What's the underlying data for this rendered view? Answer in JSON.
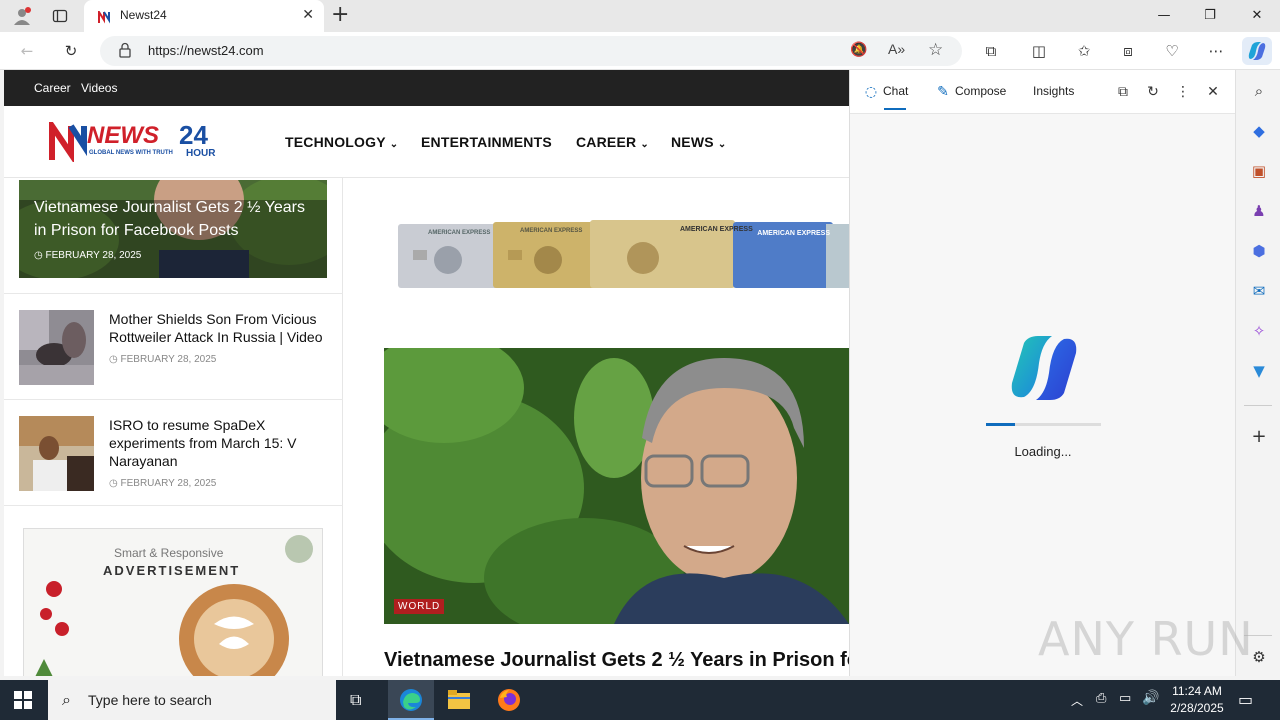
{
  "browser": {
    "tab_title": "Newst24",
    "url": "https://newst24.com",
    "win_minimize": "—",
    "win_restore": "❐",
    "win_close": "✕",
    "new_tab": "+"
  },
  "site": {
    "topnav": [
      "Career",
      "Videos"
    ],
    "logo_main": "NEWS",
    "logo_num": "24",
    "logo_hour": "HOUR",
    "logo_tagline": "GLOBAL NEWS WITH TRUTH",
    "menu": [
      {
        "label": "TECHNOLOGY",
        "caret": "⌄"
      },
      {
        "label": "ENTERTAINMENTS",
        "caret": ""
      },
      {
        "label": "CAREER",
        "caret": "⌄"
      },
      {
        "label": "NEWS",
        "caret": "⌄"
      }
    ]
  },
  "sidebar_news": {
    "feature": {
      "title": "Vietnamese Journalist Gets 2 ½ Years in Prison for Facebook Posts",
      "date": "FEBRUARY 28, 2025"
    },
    "items": [
      {
        "title": "Mother Shields Son From Vicious Rottweiler Attack In Russia | Video",
        "date": "FEBRUARY 28, 2025"
      },
      {
        "title": "ISRO to resume SpaDeX experiments from March 15: V Narayanan",
        "date": "FEBRUARY 28, 2025"
      }
    ],
    "ad": {
      "line1": "Smart & Responsive",
      "line2": "ADVERTISEMENT"
    }
  },
  "main": {
    "card_labels": [
      "AMERICAN EXPRESS",
      "AMERICAN EXPRESS",
      "AMERICAN EXPRESS",
      "AMERICAN EXPRESS"
    ],
    "hero_badge": "WORLD",
    "hero_title": "Vietnamese Journalist Gets 2 ½ Years in Prison fo"
  },
  "copilot": {
    "tabs": [
      "Chat",
      "Compose",
      "Insights"
    ],
    "loading_text": "Loading...",
    "loading_progress": 0.25
  },
  "taskbar": {
    "search_placeholder": "Type here to search",
    "time": "11:24 AM",
    "date": "2/28/2025"
  },
  "watermark": "ANY RUN",
  "colors": {
    "accent": "#0f6cbd",
    "brand_red": "#d0202a",
    "brand_blue": "#1a4fa3",
    "badge_red": "#b01f1f"
  }
}
